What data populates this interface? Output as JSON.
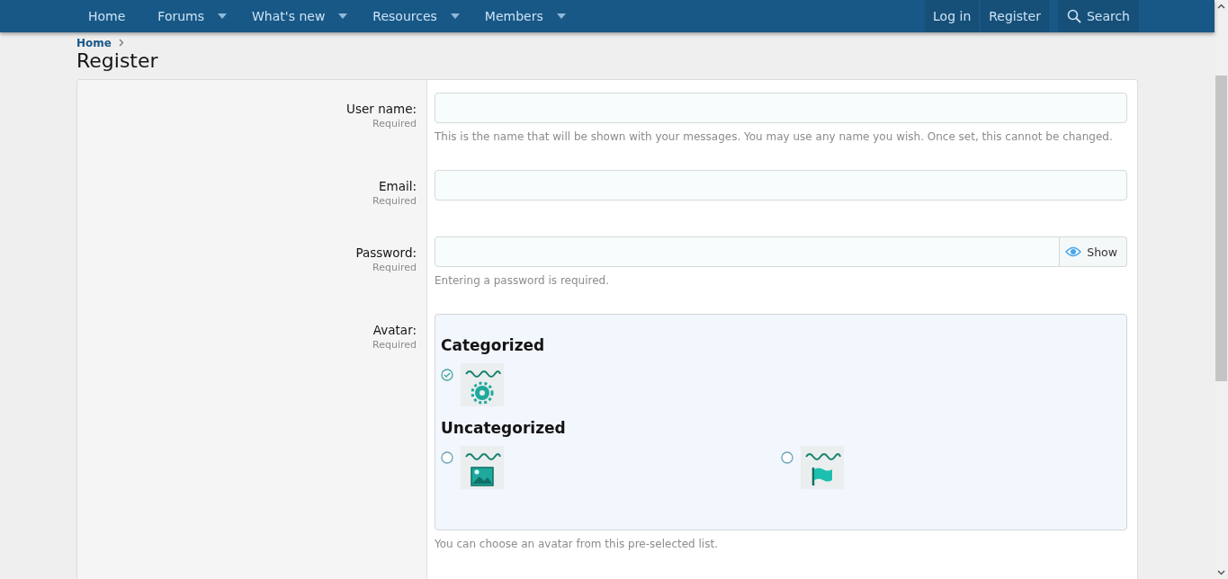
{
  "nav": {
    "items": [
      {
        "label": "Home",
        "has_menu": false
      },
      {
        "label": "Forums",
        "has_menu": true
      },
      {
        "label": "What's new",
        "has_menu": true
      },
      {
        "label": "Resources",
        "has_menu": true
      },
      {
        "label": "Members",
        "has_menu": true
      }
    ],
    "account": [
      "Log in",
      "Register"
    ],
    "search": "Search"
  },
  "breadcrumb": [
    "Home"
  ],
  "title": "Register",
  "fields": [
    {
      "label": "User name:",
      "hint": "Required",
      "kind": "text",
      "explain": "This is the name that will be shown with your messages. You may use any name you wish. Once set, this cannot be changed."
    },
    {
      "label": "Email:",
      "hint": "Required",
      "kind": "text"
    },
    {
      "label": "Password:",
      "hint": "Required",
      "kind": "password",
      "toggle": "Show",
      "explain": "Entering a password is required."
    },
    {
      "label": "Avatar:",
      "hint": "Required",
      "kind": "avatar",
      "explain": "You can choose an avatar from this pre-selected list."
    }
  ],
  "avatar_groups": [
    {
      "title": "Categorized",
      "avatars": [
        {
          "kind": "gear",
          "selected": true
        }
      ]
    },
    {
      "title": "Uncategorized",
      "avatars": [
        {
          "kind": "image",
          "selected": false
        },
        {
          "kind": "flag",
          "selected": false
        }
      ]
    }
  ]
}
